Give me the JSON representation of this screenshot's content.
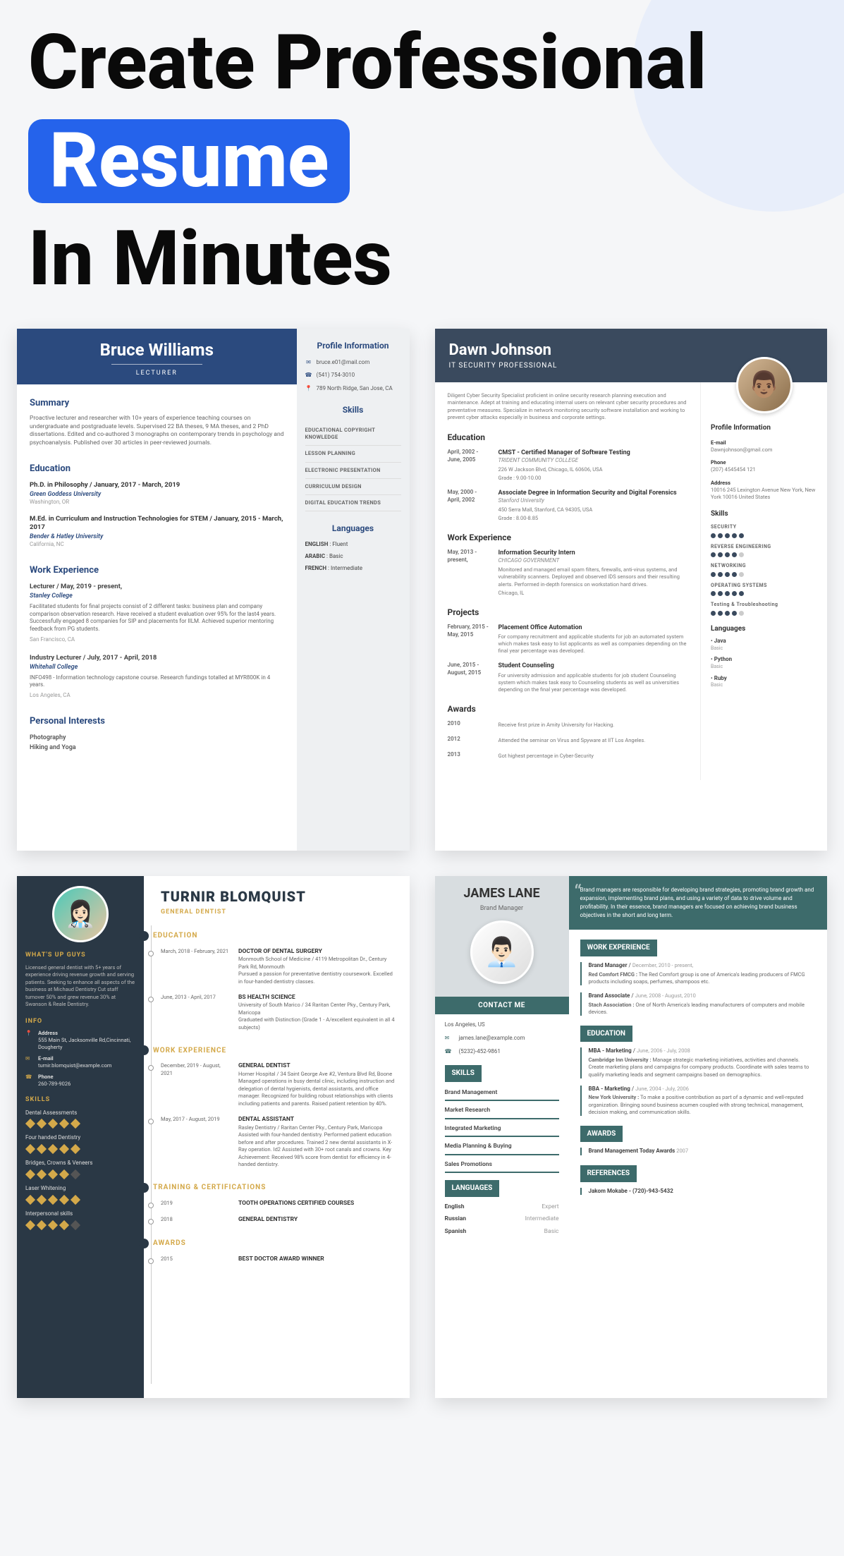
{
  "hero": {
    "line1": "Create Professional",
    "highlight": "Resume",
    "line3": "In Minutes"
  },
  "c1": {
    "name": "Bruce Williams",
    "role": "LECTURER",
    "summary_h": "Summary",
    "summary": "Proactive lecturer and researcher with 10+ years of experience teaching courses on undergraduate and postgraduate levels. Supervised 22 BA theses, 9 MA theses, and 2 PhD dissertations. Edited and co-authored 3 monographs on contemporary trends in psychology and psychoanalysis. Published over 30 articles in peer-reviewed journals.",
    "edu_h": "Education",
    "edu": [
      {
        "t": "Ph.D. in Philosophy / January, 2017 - March, 2019",
        "sch": "Green Goddess University",
        "loc": "Washington, OR"
      },
      {
        "t": "M.Ed. in Curriculum and Instruction Technologies for STEM / January, 2015 - March, 2017",
        "sch": "Bender & Hatley University",
        "loc": "California, NC"
      }
    ],
    "exp_h": "Work Experience",
    "exp": [
      {
        "t": "Lecturer / May, 2019 - present,",
        "co": "Stanley College",
        "d": "Facilitated students for final projects consist of 2 different tasks: business plan and company comparison observation research. Have received a student evaluation over 95% for the last4 years. Successfully engaged 8 companies for SIP and placements for IILM. Achieved superior mentoring feedback from PG students.",
        "loc": "San Francisco, CA"
      },
      {
        "t": "Industry Lecturer / July, 2017 - April, 2018",
        "co": "Whitehall College",
        "d": "INFO498 - Information technology capstone course. Research fundings totalled at MYR800K in 4 years.",
        "loc": "Los Angeles, CA"
      }
    ],
    "pi_h": "Personal Interests",
    "pi": [
      "Photography",
      "Hiking and Yoga"
    ],
    "side_h": "Profile Information",
    "contacts": [
      {
        "ic": "✉",
        "v": "bruce.e01@mail.com"
      },
      {
        "ic": "☎",
        "v": "(541) 754-3010"
      },
      {
        "ic": "📍",
        "v": "789 North Ridge, San Jose, CA"
      }
    ],
    "skills_h": "Skills",
    "skills": [
      "EDUCATIONAL COPYRIGHT KNOWLEDGE",
      "LESSON PLANNING",
      "ELECTRONIC PRESENTATION",
      "CURRICULUM DESIGN",
      "DIGITAL EDUCATION TRENDS"
    ],
    "lang_h": "Languages",
    "langs": [
      {
        "n": "ENGLISH",
        "lv": "Fluent"
      },
      {
        "n": "ARABIC",
        "lv": "Basic"
      },
      {
        "n": "FRENCH",
        "lv": "Intermediate"
      }
    ]
  },
  "c2": {
    "name": "Dawn Johnson",
    "role": "IT SECURITY PROFESSIONAL",
    "intro": "Diligent Cyber Security Specialist proficient in online security research planning execution and maintenance. Adept at training and educating internal users on relevant cyber security procedures and preventative measures. Specialize in network monitoring security software installation and working to prevent cyber attacks especially in business and corporate settings.",
    "edu_h": "Education",
    "edu": [
      {
        "dt": "April, 2002 - June, 2005",
        "t": "CMST - Certified Manager of Software Testing",
        "s": "TRIDENT COMMUNITY COLLEGE",
        "d": "226 W Jackson Blvd, Chicago, IL 60606, USA",
        "g": "Grade : 9.00-10.00"
      },
      {
        "dt": "May, 2000 - April, 2002",
        "t": "Associate Degree in Information Security and Digital Forensics",
        "s": "Stanford University",
        "d": "450 Serra Mall, Stanford, CA 94305, USA",
        "g": "Grade : 8.00-8.85"
      }
    ],
    "exp_h": "Work Experience",
    "exp": [
      {
        "dt": "May, 2013 - present,",
        "t": "Information Security Intern",
        "s": "CHICAGO GOVERNMENT",
        "d": "Monitored and managed email spam filters, firewalls, anti-virus systems, and vulnerability scanners. Deployed and observed IDS sensors and their resulting alerts. Performed in-depth forensics on workstation hard drives.",
        "loc": "Chicago, IL"
      }
    ],
    "proj_h": "Projects",
    "proj": [
      {
        "dt": "February, 2015 - May, 2015",
        "t": "Placement Office Automation",
        "d": "For company recruitment and applicable students for job an automated system which makes task easy to list applicants as well as companies depending on the final year percentage was developed."
      },
      {
        "dt": "June, 2015 - August, 2015",
        "t": "Student Counseling",
        "d": "For university admission and applicable students for job student Counseling system which makes task easy to Counseling students as well as universities depending on the final year percentage was developed."
      }
    ],
    "aw_h": "Awards",
    "aw": [
      {
        "dt": "2010",
        "d": "Receive first prize in Amity University for Hacking."
      },
      {
        "dt": "2012",
        "d": "Attended the seminar on Virus and Spyware at IIT Los Angeles."
      },
      {
        "dt": "2013",
        "d": "Got highest percentage in Cyber-Security"
      }
    ],
    "ph": "Profile Information",
    "pi": [
      {
        "l": "E-mail",
        "v": "Dawnjohnson@gmail.com"
      },
      {
        "l": "Phone",
        "v": "(207) 4545454 121"
      },
      {
        "l": "Address",
        "v": "10016 245 Lexington Avenue New York, New York 10016 United States"
      }
    ],
    "sk_h": "Skills",
    "sk": [
      {
        "n": "SECURITY",
        "r": 5
      },
      {
        "n": "REVERSE ENGINEERING",
        "r": 4
      },
      {
        "n": "NETWORKING",
        "r": 4
      },
      {
        "n": "OPERATING SYSTEMS",
        "r": 5
      },
      {
        "n": "Testing & Troubleshooting",
        "r": 4
      }
    ],
    "lg_h": "Languages",
    "lg": [
      {
        "n": "Java",
        "lv": "Basic"
      },
      {
        "n": "Python",
        "lv": "Basic"
      },
      {
        "n": "Ruby",
        "lv": "Basic"
      }
    ]
  },
  "c3": {
    "name": "TURNIR BLOMQUIST",
    "role": "GENERAL DENTIST",
    "wh": "WHAT'S UP GUYS",
    "intro": "Licensed general dentist with 5+ years of experience driving revenue growth and serving patients. Seeking to enhance all aspects of the business at Michaud Dentistry Cut staff turnover 50% and grew revenue 30% at Swanson & Reale Dentistry.",
    "info_h": "INFO",
    "contacts": [
      {
        "ic": "📍",
        "lbl": "Address",
        "v": "555 Main St, Jacksonville Rd,Cincinnati, Dougherty"
      },
      {
        "ic": "✉",
        "lbl": "E-mail",
        "v": "turnir.blomquist@example.com"
      },
      {
        "ic": "☎",
        "lbl": "Phone",
        "v": "260-789-9026"
      }
    ],
    "sk_h": "SKILLS",
    "sk": [
      {
        "n": "Dental Assessments",
        "r": 5
      },
      {
        "n": "Four handed Dentistry",
        "r": 5
      },
      {
        "n": "Bridges, Crowns & Veneers",
        "r": 4
      },
      {
        "n": "Laser Whitening",
        "r": 5
      },
      {
        "n": "Interpersonal skills",
        "r": 4
      }
    ],
    "edu_h": "EDUCATION",
    "edu_ic": "✎",
    "edu": [
      {
        "dt": "March, 2018 - February, 2021",
        "t": "DOCTOR OF DENTAL SURGERY",
        "d": "Monmouth School of Medicine / 4119 Metropolitan Dr., Century Park Rd, Monmouth\nPursued a passion for preventative dentistry coursework. Excelled in four-handed dentistry classes."
      },
      {
        "dt": "June, 2013 - April, 2017",
        "t": "BS HEALTH SCIENCE",
        "d": "University of South Marico / 34 Raritan Center Pky., Century Park, Maricopa\nGraduated with Distinction (Grade 1 - A/excellent equivalent in all 4 subjects)"
      }
    ],
    "exp_h": "WORK EXPERIENCE",
    "exp_ic": "💼",
    "exp": [
      {
        "dt": "December, 2019 - August, 2021",
        "t": "GENERAL DENTIST",
        "d": "Horner Hospital / 34 Saint George Ave #2, Ventura Blvd Rd, Boone\nManaged operations in busy dental clinic, including instruction and delegation of dental hygienists, dental assistants, and office manager. Recognized for building robust relationships with clients including patients and parents. Raised patient retention by 40%."
      },
      {
        "dt": "May, 2017 - August, 2019",
        "t": "DENTAL ASSISTANT",
        "d": "Rasley Dentistry / Raritan Center Pky., Century Park, Maricopa\nAssisted with four-handed dentistry. Performed patient education before and after procedures. Trained 2 new dental assistants in X-Ray operation. Id2 Assisted with 30+ root canals and crowns. Key Achievement: Received 98% score from dentist for efficiency in 4-handed dentistry."
      }
    ],
    "tc_h": "TRAINING & CERTIFICATIONS",
    "tc_ic": "📜",
    "tc": [
      {
        "dt": "2019",
        "t": "TOOTH OPERATIONS CERTIFIED COURSES"
      },
      {
        "dt": "2018",
        "t": "GENERAL DENTISTRY"
      }
    ],
    "aw_h": "AWARDS",
    "aw_ic": "🏆",
    "aw": [
      {
        "dt": "2015",
        "t": "BEST DOCTOR AWARD WINNER"
      }
    ]
  },
  "c4": {
    "name": "JAMES LANE",
    "role": "Brand Manager",
    "cm_h": "CONTACT ME",
    "loc": "Los Angeles, US",
    "contacts": [
      {
        "ic": "✉",
        "v": "james.lane@example.com"
      },
      {
        "ic": "☎",
        "v": "(5232)-452-9861"
      }
    ],
    "sk_h": "SKILLS",
    "sk": [
      "Brand Management",
      "Market Research",
      "Integrated Marketing",
      "Media Planning & Buying",
      "Sales Promotions"
    ],
    "lg_h": "LANGUAGES",
    "lg": [
      {
        "n": "English",
        "lv": "Expert"
      },
      {
        "n": "Russian",
        "lv": "Intermediate"
      },
      {
        "n": "Spanish",
        "lv": "Basic"
      }
    ],
    "quote": "Brand managers are responsible for developing brand strategies, promoting brand growth and expansion, implementing brand plans, and using a variety of data to drive volume and profitability. In their essence, brand managers are focused on achieving brand business objectives in the short and long term.",
    "exp_h": "WORK EXPERIENCE",
    "exp": [
      {
        "t": "Brand Manager",
        "dt": "December, 2010 - present,",
        "co": "Red Comfort FMCG :",
        "d": "The Red Comfort group is one of America's leading producers of FMCG products including soaps, perfumes, shampoos etc."
      },
      {
        "t": "Brand Associate",
        "dt": "June, 2008 - August, 2010",
        "co": "Stach Association :",
        "d": "One of North America's leading manufacturers of computers and mobile devices."
      }
    ],
    "edu_h": "EDUCATION",
    "edu": [
      {
        "t": "MBA - Marketing",
        "dt": "June, 2006 - July, 2008",
        "co": "Cambridge Inn University :",
        "d": "Manage strategic marketing initiatives, activities and channels. Create marketing plans and campaigns for company products. Coordinate with sales teams to qualify marketing leads and segment campaigns based on demographics."
      },
      {
        "t": "BBA - Marketing",
        "dt": "June, 2004 - July, 2006",
        "co": "New York University :",
        "d": "To make a positive contribution as part of a dynamic and well-reputed organization. Bringing sound business acumen coupled with strong technical, management, decision making, and communication skills."
      }
    ],
    "aw_h": "AWARDS",
    "aw": [
      {
        "t": "Brand Management Today Awards",
        "dt": "2007"
      }
    ],
    "ref_h": "REFERENCES",
    "ref": [
      {
        "t": "Jakom Mokabe - (720)-943-5432"
      }
    ]
  }
}
